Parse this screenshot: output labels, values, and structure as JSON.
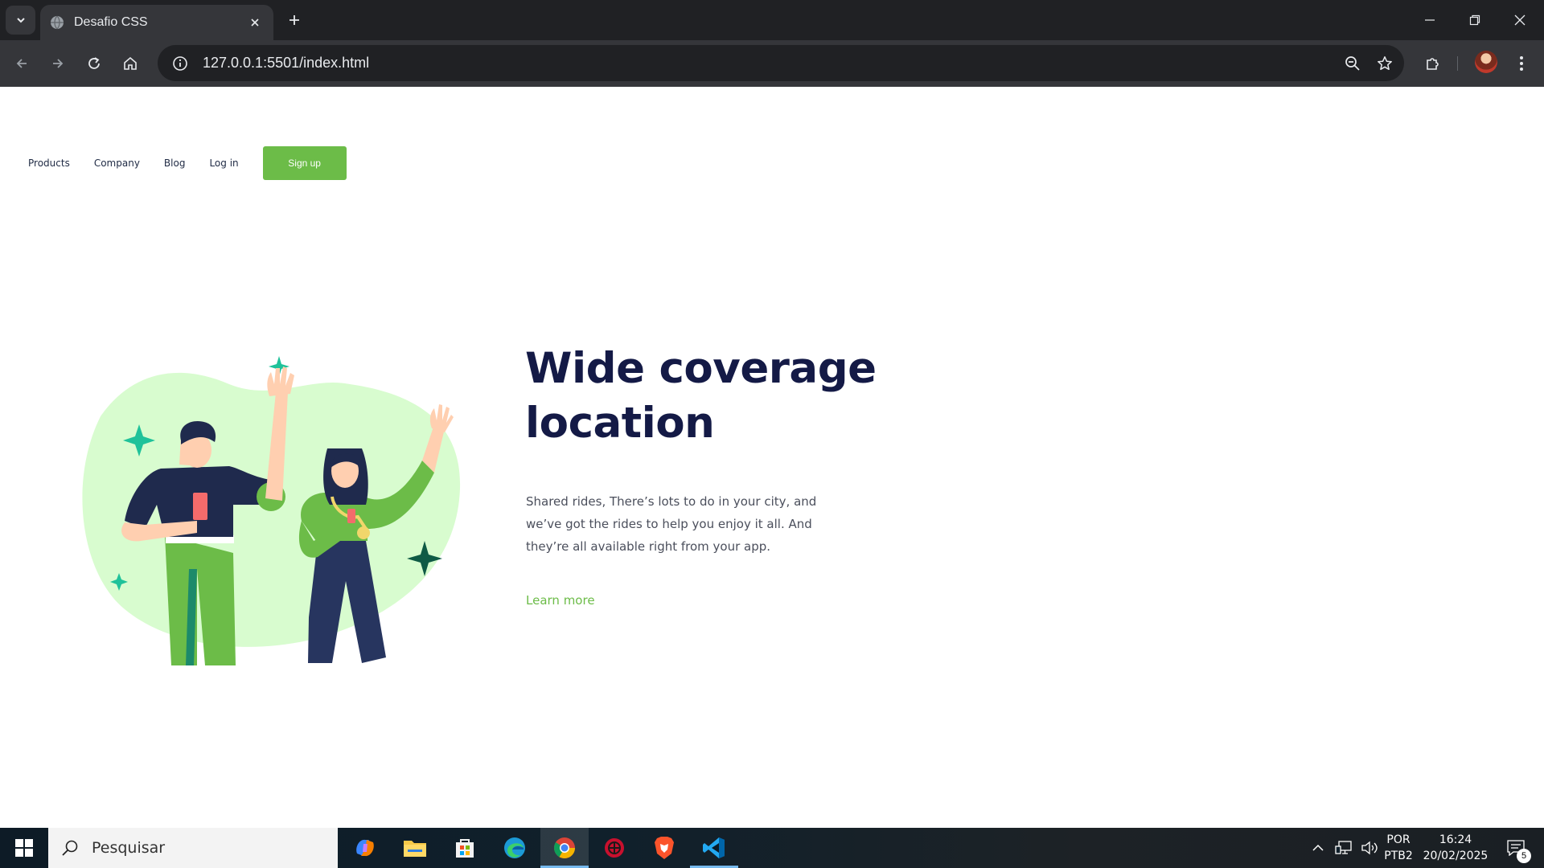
{
  "browser": {
    "tab_title": "Desafio CSS",
    "url": "127.0.0.1:5501/index.html"
  },
  "nav": {
    "items": [
      "Products",
      "Company",
      "Blog",
      "Log in"
    ],
    "signup_label": "Sign up"
  },
  "hero": {
    "title": "Wide coverage location",
    "description": "Shared rides, There’s lots to do in your city, and we’ve got the rides to help you enjoy it all. And they’re all available right from your app.",
    "link_label": "Learn more"
  },
  "taskbar": {
    "search_placeholder": "Pesquisar",
    "language_top": "POR",
    "language_bottom": "PTB2",
    "time": "16:24",
    "date": "20/02/2025",
    "notification_count": "5"
  },
  "colors": {
    "accent_green": "#6cbc48",
    "title_navy": "#141a46",
    "blob_green": "#d8fccf"
  }
}
